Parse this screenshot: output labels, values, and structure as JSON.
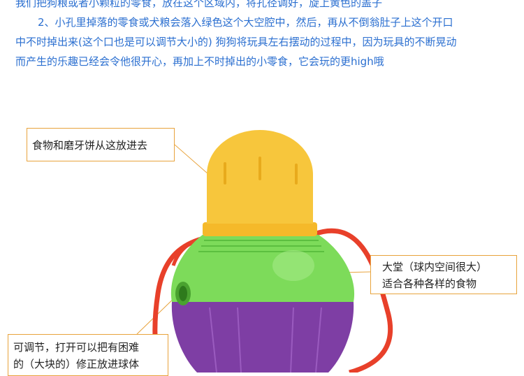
{
  "description": {
    "line_top": "我们把狗粮或者小颗粒的零食，放在这个区域内，将孔径调好，旋上黄色的盖子",
    "paragraph2_line1": "2、小孔里掉落的零食或犬粮会落入绿色这个大空腔中，然后，再从不倒翁肚子上这个开口",
    "paragraph2_line2": "中不时掉出来(这个口也是可以调节大小的) 狗狗将玩具左右摆动的过程中，因为玩具的不断晃动",
    "paragraph2_line3": "而产生的乐趣已经会令他很开心，再加上不时掉出的小零食，它会玩的更high哦"
  },
  "callouts": {
    "top_label": "食物和磨牙饼从这放进去",
    "middle_line1": "大堂（球内空间很大）",
    "middle_line2": "适合各种各样的食物",
    "bottom_line1": "可调节，打开可以把有困难",
    "bottom_line2": "的（大块的）修正放进球体"
  },
  "colors": {
    "text_blue": "#2b6fd0",
    "cap_yellow": "#f7c63c",
    "body_green": "#7ddb5a",
    "base_purple": "#7e3ea4",
    "strap_red": "#e8402a",
    "callout_border": "#e8a33c"
  }
}
